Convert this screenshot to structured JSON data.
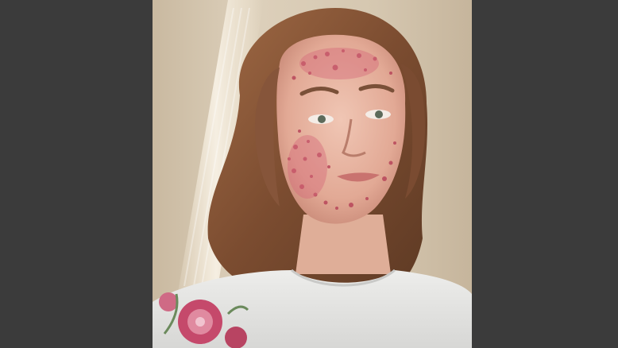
{
  "image": {
    "subject": "selfie-portrait",
    "background_color": "#3b3b3b",
    "photo_palette": {
      "wall": "#d6c8b2",
      "hair": "#8a5a3a",
      "skin": "#e9b9a6",
      "sweater": "#e6e6e4",
      "blemish": "#b8465a",
      "embroidery": "#c5496b"
    }
  }
}
